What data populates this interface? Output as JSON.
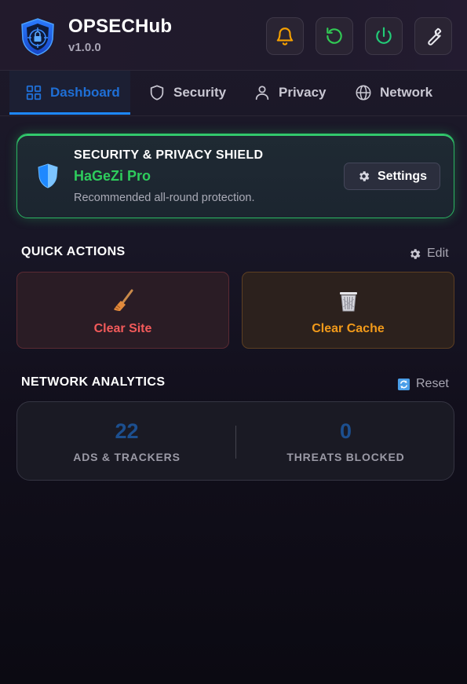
{
  "app": {
    "title": "OPSECHub",
    "version": "v1.0.0"
  },
  "header_buttons": [
    {
      "name": "notifications",
      "icon": "bell-icon",
      "color": "#f5a000"
    },
    {
      "name": "refresh",
      "icon": "refresh-icon",
      "color": "#31c954"
    },
    {
      "name": "power",
      "icon": "power-icon",
      "color": "#22cc77"
    },
    {
      "name": "tools",
      "icon": "wrench-icon",
      "color": "#e8e8ee"
    }
  ],
  "tabs": [
    {
      "label": "Dashboard",
      "icon": "grid-icon",
      "active": true
    },
    {
      "label": "Security",
      "icon": "shield-icon",
      "active": false
    },
    {
      "label": "Privacy",
      "icon": "user-icon",
      "active": false
    },
    {
      "label": "Network",
      "icon": "globe-icon",
      "active": false
    }
  ],
  "shield": {
    "title": "SECURITY & PRIVACY SHIELD",
    "name": "HaGeZi Pro",
    "description": "Recommended all-round protection.",
    "settings_label": "Settings",
    "accent": "#2ecc5c"
  },
  "quick_actions": {
    "title": "QUICK ACTIONS",
    "edit_label": "Edit",
    "items": [
      {
        "label": "Clear Site",
        "icon": "broom-icon",
        "color": "#f25a5a"
      },
      {
        "label": "Clear Cache",
        "icon": "trash-icon",
        "color": "#f29a1a"
      }
    ]
  },
  "analytics": {
    "title": "NETWORK ANALYTICS",
    "reset_label": "Reset",
    "stats": [
      {
        "value": "22",
        "label": "ADS & TRACKERS"
      },
      {
        "value": "0",
        "label": "THREATS BLOCKED"
      }
    ]
  }
}
